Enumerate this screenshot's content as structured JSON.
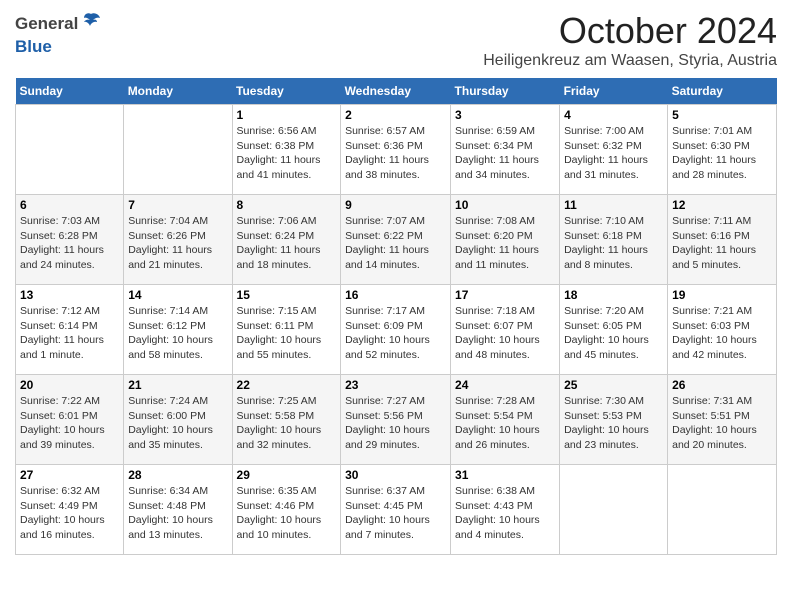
{
  "header": {
    "logo_general": "General",
    "logo_blue": "Blue",
    "month_title": "October 2024",
    "location": "Heiligenkreuz am Waasen, Styria, Austria"
  },
  "weekdays": [
    "Sunday",
    "Monday",
    "Tuesday",
    "Wednesday",
    "Thursday",
    "Friday",
    "Saturday"
  ],
  "weeks": [
    [
      {
        "day": "",
        "info": ""
      },
      {
        "day": "",
        "info": ""
      },
      {
        "day": "1",
        "info": "Sunrise: 6:56 AM\nSunset: 6:38 PM\nDaylight: 11 hours and 41 minutes."
      },
      {
        "day": "2",
        "info": "Sunrise: 6:57 AM\nSunset: 6:36 PM\nDaylight: 11 hours and 38 minutes."
      },
      {
        "day": "3",
        "info": "Sunrise: 6:59 AM\nSunset: 6:34 PM\nDaylight: 11 hours and 34 minutes."
      },
      {
        "day": "4",
        "info": "Sunrise: 7:00 AM\nSunset: 6:32 PM\nDaylight: 11 hours and 31 minutes."
      },
      {
        "day": "5",
        "info": "Sunrise: 7:01 AM\nSunset: 6:30 PM\nDaylight: 11 hours and 28 minutes."
      }
    ],
    [
      {
        "day": "6",
        "info": "Sunrise: 7:03 AM\nSunset: 6:28 PM\nDaylight: 11 hours and 24 minutes."
      },
      {
        "day": "7",
        "info": "Sunrise: 7:04 AM\nSunset: 6:26 PM\nDaylight: 11 hours and 21 minutes."
      },
      {
        "day": "8",
        "info": "Sunrise: 7:06 AM\nSunset: 6:24 PM\nDaylight: 11 hours and 18 minutes."
      },
      {
        "day": "9",
        "info": "Sunrise: 7:07 AM\nSunset: 6:22 PM\nDaylight: 11 hours and 14 minutes."
      },
      {
        "day": "10",
        "info": "Sunrise: 7:08 AM\nSunset: 6:20 PM\nDaylight: 11 hours and 11 minutes."
      },
      {
        "day": "11",
        "info": "Sunrise: 7:10 AM\nSunset: 6:18 PM\nDaylight: 11 hours and 8 minutes."
      },
      {
        "day": "12",
        "info": "Sunrise: 7:11 AM\nSunset: 6:16 PM\nDaylight: 11 hours and 5 minutes."
      }
    ],
    [
      {
        "day": "13",
        "info": "Sunrise: 7:12 AM\nSunset: 6:14 PM\nDaylight: 11 hours and 1 minute."
      },
      {
        "day": "14",
        "info": "Sunrise: 7:14 AM\nSunset: 6:12 PM\nDaylight: 10 hours and 58 minutes."
      },
      {
        "day": "15",
        "info": "Sunrise: 7:15 AM\nSunset: 6:11 PM\nDaylight: 10 hours and 55 minutes."
      },
      {
        "day": "16",
        "info": "Sunrise: 7:17 AM\nSunset: 6:09 PM\nDaylight: 10 hours and 52 minutes."
      },
      {
        "day": "17",
        "info": "Sunrise: 7:18 AM\nSunset: 6:07 PM\nDaylight: 10 hours and 48 minutes."
      },
      {
        "day": "18",
        "info": "Sunrise: 7:20 AM\nSunset: 6:05 PM\nDaylight: 10 hours and 45 minutes."
      },
      {
        "day": "19",
        "info": "Sunrise: 7:21 AM\nSunset: 6:03 PM\nDaylight: 10 hours and 42 minutes."
      }
    ],
    [
      {
        "day": "20",
        "info": "Sunrise: 7:22 AM\nSunset: 6:01 PM\nDaylight: 10 hours and 39 minutes."
      },
      {
        "day": "21",
        "info": "Sunrise: 7:24 AM\nSunset: 6:00 PM\nDaylight: 10 hours and 35 minutes."
      },
      {
        "day": "22",
        "info": "Sunrise: 7:25 AM\nSunset: 5:58 PM\nDaylight: 10 hours and 32 minutes."
      },
      {
        "day": "23",
        "info": "Sunrise: 7:27 AM\nSunset: 5:56 PM\nDaylight: 10 hours and 29 minutes."
      },
      {
        "day": "24",
        "info": "Sunrise: 7:28 AM\nSunset: 5:54 PM\nDaylight: 10 hours and 26 minutes."
      },
      {
        "day": "25",
        "info": "Sunrise: 7:30 AM\nSunset: 5:53 PM\nDaylight: 10 hours and 23 minutes."
      },
      {
        "day": "26",
        "info": "Sunrise: 7:31 AM\nSunset: 5:51 PM\nDaylight: 10 hours and 20 minutes."
      }
    ],
    [
      {
        "day": "27",
        "info": "Sunrise: 6:32 AM\nSunset: 4:49 PM\nDaylight: 10 hours and 16 minutes."
      },
      {
        "day": "28",
        "info": "Sunrise: 6:34 AM\nSunset: 4:48 PM\nDaylight: 10 hours and 13 minutes."
      },
      {
        "day": "29",
        "info": "Sunrise: 6:35 AM\nSunset: 4:46 PM\nDaylight: 10 hours and 10 minutes."
      },
      {
        "day": "30",
        "info": "Sunrise: 6:37 AM\nSunset: 4:45 PM\nDaylight: 10 hours and 7 minutes."
      },
      {
        "day": "31",
        "info": "Sunrise: 6:38 AM\nSunset: 4:43 PM\nDaylight: 10 hours and 4 minutes."
      },
      {
        "day": "",
        "info": ""
      },
      {
        "day": "",
        "info": ""
      }
    ]
  ]
}
